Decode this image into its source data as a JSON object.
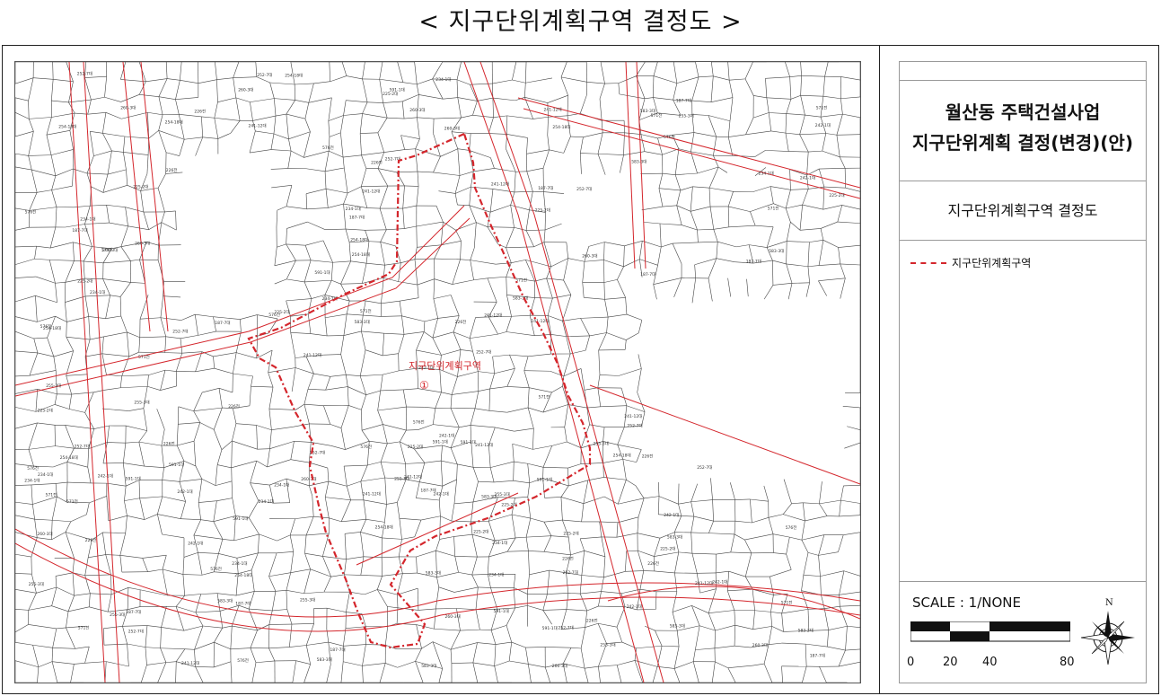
{
  "page": {
    "title": "< 지구단위계획구역 결정도 >"
  },
  "panel": {
    "title_line1": "월산동 주택건설사업",
    "title_line2": "지구단위계획 결정(변경)(안)",
    "subtitle": "지구단위계획구역 결정도",
    "legend_label": "지구단위계획구역",
    "legend_color": "#d4262c",
    "scale_text": "SCALE : 1/NONE",
    "scale_ticks": [
      "0",
      "20",
      "40",
      "80"
    ],
    "north_label": "N"
  },
  "map": {
    "zone_label": "지구단위계획구역",
    "zone_marker": "①",
    "zone_color": "#d4262c",
    "road_color": "#d4262c",
    "parcel_color": "#444444",
    "parcel_labels": [
      "234-1대",
      "254-18대",
      "252-7대",
      "241-12대",
      "242-1대",
      "187-7대",
      "225-2대",
      "226전",
      "591-1대",
      "583-3대",
      "576전",
      "571전",
      "255-3대",
      "260-3대"
    ]
  }
}
